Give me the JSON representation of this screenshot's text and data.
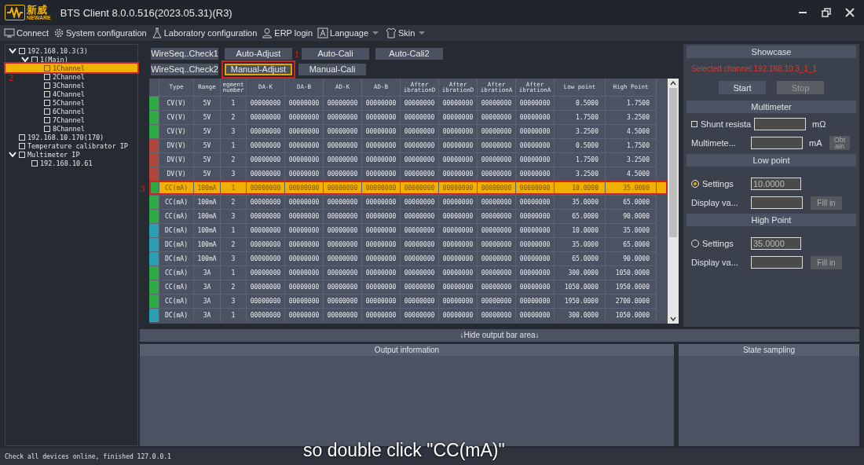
{
  "window": {
    "logo_cn": "新威",
    "logo_en": "NEWARE",
    "title": "BTS Client 8.0.0.516(2023.05.31)(R3)"
  },
  "menu": [
    {
      "label": "Connect",
      "dropdown": false
    },
    {
      "label": "System configuration",
      "dropdown": false
    },
    {
      "label": "Laboratory configuration",
      "dropdown": false
    },
    {
      "label": "ERP login",
      "dropdown": false
    },
    {
      "label": "Language",
      "dropdown": true
    },
    {
      "label": "Skin",
      "dropdown": true
    }
  ],
  "tree": [
    {
      "label": "192.168.10.3(3)",
      "checked": false,
      "expanded": true,
      "selected": false,
      "children": [
        {
          "label": "1(Main)",
          "checked": false,
          "expanded": true,
          "selected": false,
          "children": [
            {
              "label": "1Channel",
              "checked": false,
              "selected": true,
              "highlighted": true,
              "annotation": "2"
            },
            {
              "label": "2Channel",
              "checked": false,
              "selected": false
            },
            {
              "label": "3Channel",
              "checked": false,
              "selected": false
            },
            {
              "label": "4Channel",
              "checked": false,
              "selected": false
            },
            {
              "label": "5Channel",
              "checked": false,
              "selected": false
            },
            {
              "label": "6Channel",
              "checked": false,
              "selected": false
            },
            {
              "label": "7Channel",
              "checked": false,
              "selected": false
            },
            {
              "label": "8Channel",
              "checked": false,
              "selected": false
            }
          ]
        }
      ]
    },
    {
      "label": "192.168.10.170(170)",
      "checked": false,
      "selected": false
    },
    {
      "label": "Temperature calibrator IP",
      "checked": false,
      "selected": false
    },
    {
      "label": "Multimeter IP",
      "checked": false,
      "expanded": true,
      "selected": false,
      "children": [
        {
          "label": "192.168.10.61",
          "checked": false,
          "selected": false
        }
      ]
    }
  ],
  "tabs": [
    [
      {
        "label": "WireSeq..Check1",
        "selected": false
      },
      {
        "label": "Auto-Adjust",
        "selected": false,
        "annotation": "1"
      },
      {
        "label": "Auto-Cali",
        "selected": false
      },
      {
        "label": "Auto-Cali2",
        "selected": false
      }
    ],
    [
      {
        "label": "WireSeq..Check2",
        "selected": false
      },
      {
        "label": "Manual-Adjust",
        "selected": true,
        "highlighted": true
      },
      {
        "label": "Manual-Cali",
        "selected": false
      }
    ]
  ],
  "table": {
    "columns": [
      "Type",
      "Range",
      "egment number",
      "DA-K",
      "DA-B",
      "AD-K",
      "AD-B",
      "After ibrationD",
      "After ibrationD",
      "After ibrationA",
      "After ibrationA",
      "Low point",
      "High Point"
    ],
    "rows": [
      {
        "color": "#2eaa44",
        "selected": false,
        "cells": [
          "CV(V)",
          "5V",
          "1",
          "00000000",
          "00000000",
          "00000000",
          "00000000",
          "00000000",
          "00000000",
          "00000000",
          "00000000",
          "0.5000",
          "1.7500"
        ]
      },
      {
        "color": "#2eaa44",
        "selected": false,
        "cells": [
          "CV(V)",
          "5V",
          "2",
          "00000000",
          "00000000",
          "00000000",
          "00000000",
          "00000000",
          "00000000",
          "00000000",
          "00000000",
          "1.7500",
          "3.2500"
        ]
      },
      {
        "color": "#2eaa44",
        "selected": false,
        "cells": [
          "CV(V)",
          "5V",
          "3",
          "00000000",
          "00000000",
          "00000000",
          "00000000",
          "00000000",
          "00000000",
          "00000000",
          "00000000",
          "3.2500",
          "4.5000"
        ]
      },
      {
        "color": "#b0453c",
        "selected": false,
        "cells": [
          "DV(V)",
          "5V",
          "1",
          "00000000",
          "00000000",
          "00000000",
          "00000000",
          "00000000",
          "00000000",
          "00000000",
          "00000000",
          "0.5000",
          "1.7500"
        ]
      },
      {
        "color": "#b0453c",
        "selected": false,
        "cells": [
          "DV(V)",
          "5V",
          "2",
          "00000000",
          "00000000",
          "00000000",
          "00000000",
          "00000000",
          "00000000",
          "00000000",
          "00000000",
          "1.7500",
          "3.2500"
        ]
      },
      {
        "color": "#b0453c",
        "selected": false,
        "cells": [
          "DV(V)",
          "5V",
          "3",
          "00000000",
          "00000000",
          "00000000",
          "00000000",
          "00000000",
          "00000000",
          "00000000",
          "00000000",
          "3.2500",
          "4.5000"
        ]
      },
      {
        "color": "#2eaa44",
        "selected": true,
        "highlighted": true,
        "annotation": "3",
        "cells": [
          "CC(mA)",
          "100mA",
          "1",
          "00000000",
          "00000000",
          "00000000",
          "00000000",
          "00000000",
          "00000000",
          "00000000",
          "00000000",
          "10.0000",
          "35.0000"
        ]
      },
      {
        "color": "#2eaa44",
        "selected": false,
        "cells": [
          "CC(mA)",
          "100mA",
          "2",
          "00000000",
          "00000000",
          "00000000",
          "00000000",
          "00000000",
          "00000000",
          "00000000",
          "00000000",
          "35.0000",
          "65.0000"
        ]
      },
      {
        "color": "#2eaa44",
        "selected": false,
        "cells": [
          "CC(mA)",
          "100mA",
          "3",
          "00000000",
          "00000000",
          "00000000",
          "00000000",
          "00000000",
          "00000000",
          "00000000",
          "00000000",
          "65.0000",
          "90.0000"
        ]
      },
      {
        "color": "#2a9fb3",
        "selected": false,
        "cells": [
          "DC(mA)",
          "100mA",
          "1",
          "00000000",
          "00000000",
          "00000000",
          "00000000",
          "00000000",
          "00000000",
          "00000000",
          "00000000",
          "10.0000",
          "35.0000"
        ]
      },
      {
        "color": "#2a9fb3",
        "selected": false,
        "cells": [
          "DC(mA)",
          "100mA",
          "2",
          "00000000",
          "00000000",
          "00000000",
          "00000000",
          "00000000",
          "00000000",
          "00000000",
          "00000000",
          "35.0000",
          "65.0000"
        ]
      },
      {
        "color": "#2a9fb3",
        "selected": false,
        "cells": [
          "DC(mA)",
          "100mA",
          "3",
          "00000000",
          "00000000",
          "00000000",
          "00000000",
          "00000000",
          "00000000",
          "00000000",
          "00000000",
          "65.0000",
          "90.0000"
        ]
      },
      {
        "color": "#2eaa44",
        "selected": false,
        "cells": [
          "CC(mA)",
          "3A",
          "1",
          "00000000",
          "00000000",
          "00000000",
          "00000000",
          "00000000",
          "00000000",
          "00000000",
          "00000000",
          "300.0000",
          "1050.0000"
        ]
      },
      {
        "color": "#2eaa44",
        "selected": false,
        "cells": [
          "CC(mA)",
          "3A",
          "2",
          "00000000",
          "00000000",
          "00000000",
          "00000000",
          "00000000",
          "00000000",
          "00000000",
          "00000000",
          "1050.0000",
          "1950.0000"
        ]
      },
      {
        "color": "#2eaa44",
        "selected": false,
        "cells": [
          "CC(mA)",
          "3A",
          "3",
          "00000000",
          "00000000",
          "00000000",
          "00000000",
          "00000000",
          "00000000",
          "00000000",
          "00000000",
          "1950.0000",
          "2700.0000"
        ]
      },
      {
        "color": "#2a9fb3",
        "selected": false,
        "cells": [
          "DC(mA)",
          "3A",
          "1",
          "00000000",
          "00000000",
          "00000000",
          "00000000",
          "00000000",
          "00000000",
          "00000000",
          "00000000",
          "300.0000",
          "1050.0000"
        ]
      }
    ]
  },
  "showcase": {
    "title": "Showcase",
    "selected_channel": "Selected channel:192.168.10.3_1_1",
    "buttons": [
      {
        "label": "Start",
        "disabled": false
      },
      {
        "label": "Stop",
        "disabled": true
      }
    ]
  },
  "multimeter": {
    "title": "Multimeter",
    "shunt_label": "Shunt resista",
    "shunt_checked": false,
    "shunt_unit": "mΩ",
    "meter_label": "Multimete...",
    "meter_unit": "mA",
    "obtain_button": "Obt ain"
  },
  "points": [
    {
      "title": "Low point",
      "settings_label": "Settings",
      "settings_selected": true,
      "settings_value": "10.0000",
      "display_label": "Display va...",
      "fill_button": "Fill in"
    },
    {
      "title": "High Point",
      "settings_label": "Settings",
      "settings_selected": false,
      "settings_value": "35.0000",
      "display_label": "Display va...",
      "fill_button": "Fill in"
    }
  ],
  "hide_output_bar": "↓Hide output bar area↓",
  "output_panel": {
    "title": "Output information"
  },
  "state_panel": {
    "title": "State sampling"
  },
  "status_bar": "Check all devices online, finished 127.0.0.1",
  "video_caption": "so double click \"CC(mA)\""
}
